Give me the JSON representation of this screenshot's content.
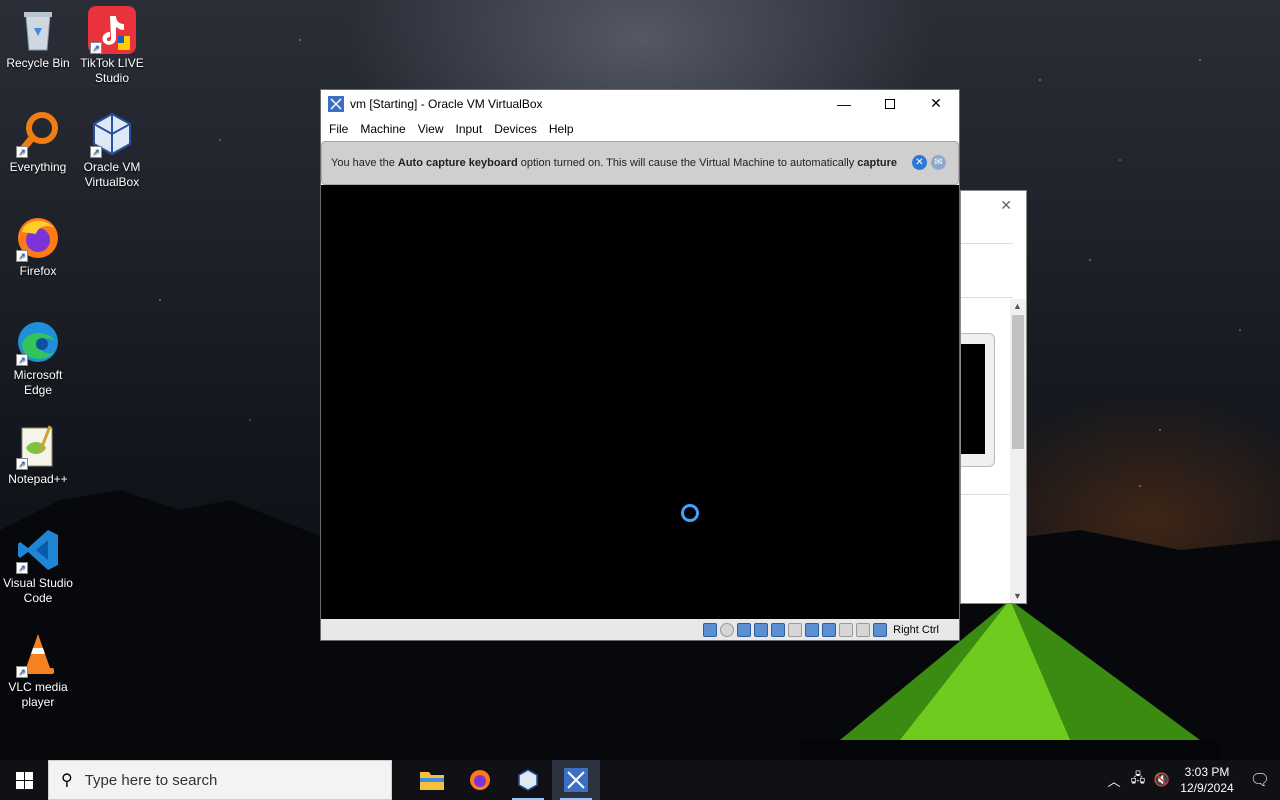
{
  "desktop": {
    "icons": [
      {
        "label": "Recycle Bin"
      },
      {
        "label": "TikTok LIVE Studio"
      },
      {
        "label": "Everything"
      },
      {
        "label": "Oracle VM VirtualBox"
      },
      {
        "label": "Firefox"
      },
      {
        "label": "Microsoft Edge"
      },
      {
        "label": "Notepad++"
      },
      {
        "label": "Visual Studio Code"
      },
      {
        "label": "VLC media player"
      }
    ]
  },
  "vbox": {
    "title": "vm [Starting] - Oracle VM VirtualBox",
    "menu": [
      "File",
      "Machine",
      "View",
      "Input",
      "Devices",
      "Help"
    ],
    "notice": {
      "prefix": "You have the ",
      "bold1": "Auto capture keyboard",
      "middle": " option turned on. This will cause the Virtual Machine to automatically ",
      "bold2": "capture"
    },
    "host_key": "Right Ctrl"
  },
  "taskbar": {
    "search_placeholder": "Type here to search",
    "time": "3:03 PM",
    "date": "12/9/2024"
  },
  "colors": {
    "accent": "#3fa3ff",
    "taskbar": "#101114",
    "notice_bg": "#cfcfcf"
  }
}
